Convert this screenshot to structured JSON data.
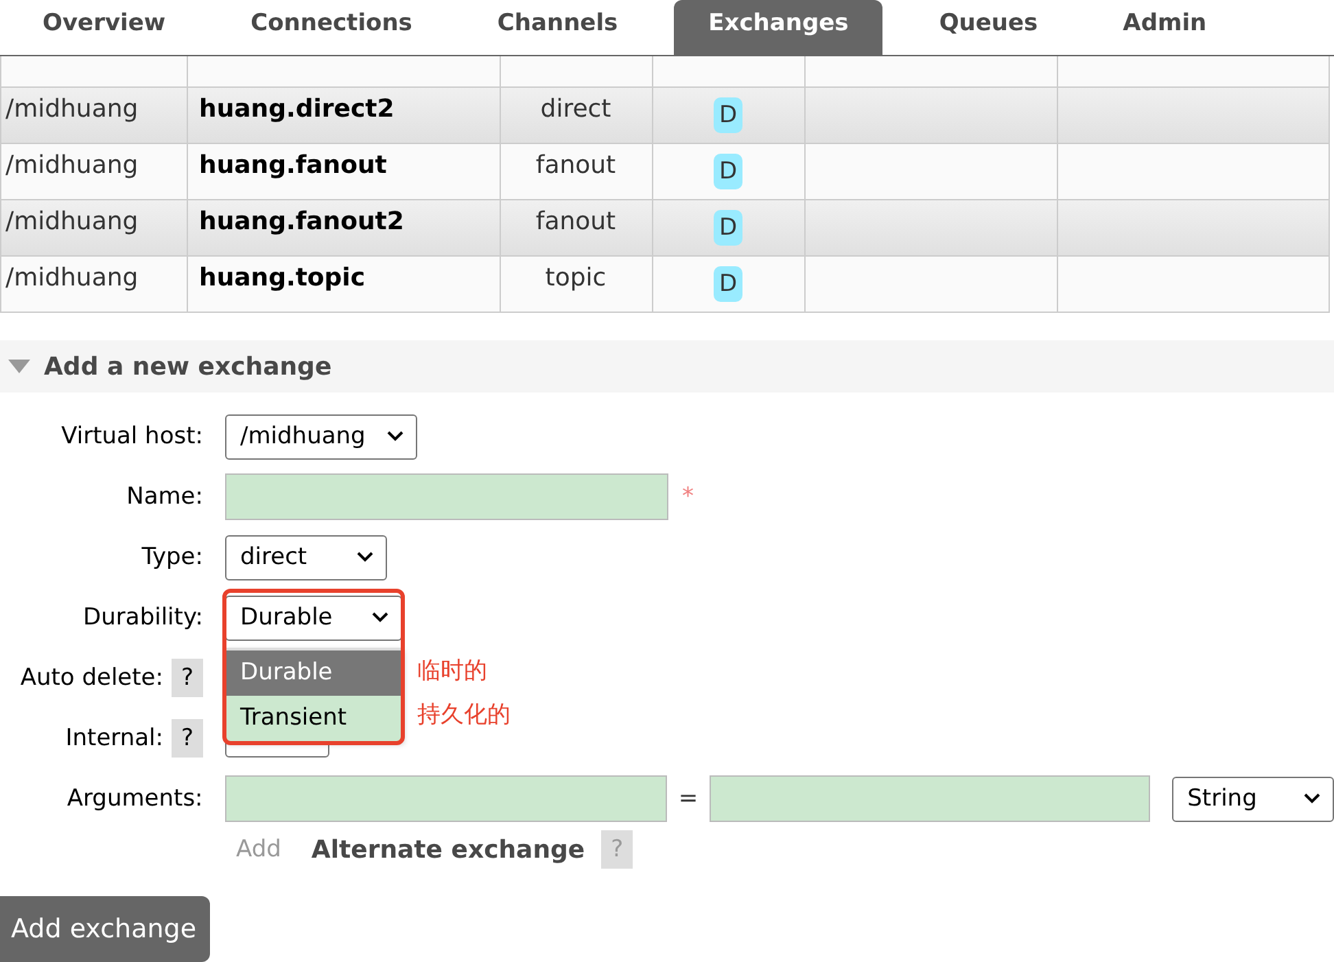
{
  "nav": {
    "tabs": [
      {
        "label": "Overview",
        "selected": false
      },
      {
        "label": "Connections",
        "selected": false
      },
      {
        "label": "Channels",
        "selected": false
      },
      {
        "label": "Exchanges",
        "selected": true
      },
      {
        "label": "Queues",
        "selected": false
      },
      {
        "label": "Admin",
        "selected": false
      }
    ]
  },
  "exchanges_table": {
    "rows": [
      {
        "virtual_host": "/midhuang",
        "name": "huang.direct2",
        "type": "direct",
        "features": "D"
      },
      {
        "virtual_host": "/midhuang",
        "name": "huang.fanout",
        "type": "fanout",
        "features": "D"
      },
      {
        "virtual_host": "/midhuang",
        "name": "huang.fanout2",
        "type": "fanout",
        "features": "D"
      },
      {
        "virtual_host": "/midhuang",
        "name": "huang.topic",
        "type": "topic",
        "features": "D"
      }
    ]
  },
  "add_exchange": {
    "title": "Add a new exchange",
    "expanded": true,
    "fields": [
      {
        "kind": "select",
        "label": "Virtual host:",
        "value": "/midhuang"
      },
      {
        "kind": "text",
        "label": "Name:",
        "required_mark": "*"
      },
      {
        "kind": "select",
        "label": "Type:",
        "value": "direct"
      },
      {
        "kind": "select",
        "label": "Durability:",
        "value": "Durable",
        "expanded": true,
        "options": [
          {
            "label": "Durable",
            "selected": true
          },
          {
            "label": "Transient",
            "selected": false
          }
        ],
        "annotations": [
          "临时的",
          "持久化的"
        ]
      },
      {
        "kind": "hidden",
        "label": "Auto delete:",
        "help": "?"
      },
      {
        "kind": "covered",
        "label": "Internal:",
        "help": "?"
      },
      {
        "kind": "arguments",
        "label": "Arguments:",
        "equals": "=",
        "type_value": "String"
      }
    ],
    "add_link": "Add",
    "alternate": {
      "label": "Alternate exchange",
      "help": "?"
    },
    "submit": "Add exchange"
  }
}
